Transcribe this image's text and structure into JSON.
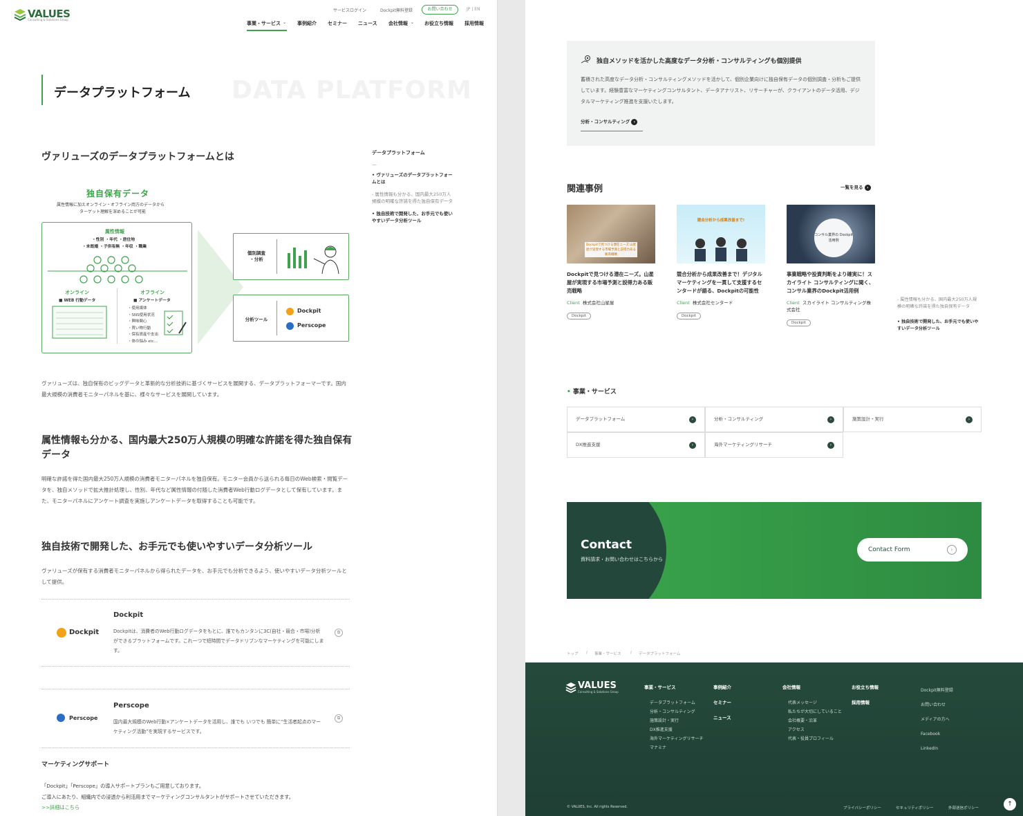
{
  "header": {
    "logo_text": "VALUES",
    "logo_sub": "Consulting & Solutions Group",
    "util": [
      "サービスログイン",
      "Dockpit無料登録"
    ],
    "contact_label": "お問い合わせ",
    "lang": "JP | EN",
    "nav": [
      "事業・サービス",
      "事例紹介",
      "セミナー",
      "ニュース",
      "会社情報",
      "お役立ち情報",
      "採用情報"
    ],
    "dropdown_marker": "⌄"
  },
  "page": {
    "title": "データプラットフォーム",
    "title_en": "DATA PLATFORM"
  },
  "toc": {
    "title": "データプラットフォーム",
    "dash": "—",
    "items": [
      "ヴァリューズのデータプラットフォームとは",
      "属性情報も分かる、国内最大250万人規模の明確な許諾を得た独自保有データ",
      "独自技術で開発した、お手元でも使いやすいデータ分析ツール"
    ]
  },
  "section1": {
    "heading": "ヴァリューズのデータプラットフォームとは",
    "body": "ヴァリューズは、独自保有のビッグデータと革新的な分析技術に基づくサービスを展開する、データプラットフォーマーです。国内最大規模の消費者モニターパネルを基に、様々なサービスを展開しています。"
  },
  "diagram": {
    "title": "独自保有データ",
    "subtitle1": "属性情報に加えオンライン・オフライン両方のデータから",
    "subtitle2": "ターゲット理解を深めることが可能",
    "attr_title": "属性情報",
    "attr_line1": "・性別 ・年代 ・居住地",
    "attr_line2": "・未既婚 ・子供有無 ・年収 ・職業",
    "online": "オンライン",
    "online_item": "■ WEB 行動データ",
    "offline": "オフライン",
    "offline_item": "■ アンケートデータ",
    "offline_list": [
      "・使用媒体",
      "・SNS使用状況",
      "・興味関心",
      "・買い物行動",
      "・保有資産や支出",
      "・体の悩み etc..."
    ],
    "box1_label": "個別調査\n・分析",
    "box2_label": "分析ツール",
    "tool1": "Dockpit",
    "tool2": "Perscope"
  },
  "section2": {
    "heading": "属性情報も分かる、国内最大250万人規模の明確な許諾を得た独自保有データ",
    "body": "明確な許諾を得た国内最大250万人規模の消費者モニターパネルを独自保有。モニター会員から送られる毎日のWeb検索・閲覧データを、独自メソッドで拡大推計処理し、性別、年代など属性情報の付随した消費者Web行動ログデータとして保有しています。また、モニターパネルにアンケート調査を実施しアンケートデータを取得することも可能です。"
  },
  "section3": {
    "heading": "独自技術で開発した、お手元でも使いやすいデータ分析ツール",
    "body": "ヴァリューズが保有する消費者モニターパネルから得られたデータを、お手元でも分析できるよう、使いやすいデータ分析ツールとして提供。",
    "tools": [
      {
        "logo": "Dockpit",
        "name": "Dockpit",
        "desc": "Dockpitは、消費者のWeb行動ログデータをもとに、誰でもカンタンに3C(自社・競合・市場)分析ができるプラットフォームです。これ一つで短時間でデータドリブンなマーケティングを可能にします。"
      },
      {
        "logo": "Perscope",
        "name": "Perscope",
        "desc": "国内最大規模のWeb行動×アンケートデータを活用し、誰でも いつでも 簡単に“生活者起点のマーケティング活動”を実現するサービスです。"
      }
    ],
    "support_heading": "マーケティングサポート",
    "support_body1": "「Dockpit」「Perscope」の導入サポートプランもご用意しております。",
    "support_body2": "ご導入にあたり、組織内での浸透から利活用までマーケティングコンサルタントがサポートさせていただきます。",
    "support_link": ">>詳細はこちら"
  },
  "consult": {
    "heading": "独自メソッドを活かした高度なデータ分析・コンサルティングも個別提供",
    "body": "蓄積された高度なデータ分析・コンサルティングメソッドを活かして、個別企業向けに独自保有データの個別調査・分析もご提供しています。経験豊富なマーケティングコンサルタント、データアナリスト、リサーチャーが、クライアントのデータ活用、デジタルマーケティング推進を支援いたします。",
    "link": "分析・コンサルティング"
  },
  "cases": {
    "heading": "関連事例",
    "more": "一覧を見る",
    "client_label": "Client",
    "items": [
      {
        "title": "Dockpitで見つける潜在ニーズ。山星屋が実現する市場予測と説得力ある販売戦略",
        "client": "株式会社山星屋",
        "tag": "Dockpit",
        "img_caption": "Dockpitで見つける潜在ニーズ 山星屋が実現する市場予測と説得力ある販売戦略"
      },
      {
        "title": "競合分析から成果改善まで！デジタルマーケティングを一貫して支援するセンタードが語る、Dockpitの可能性",
        "client": "株式会社センタード",
        "tag": "Dockpit",
        "img_caption": "競合分析から成果改善まで!"
      },
      {
        "title": "事業戦略や投資判断をより確実に！スカイライト コンサルティングに聞く、コンサル業界のDockpit活用例",
        "client": "スカイライト コンサルティング株式会社",
        "tag": "Dockpit",
        "img_caption": "コンサル業界の Dockpit活用例"
      }
    ]
  },
  "right_toc": [
    "属性情報も分かる、国内最大250万人規模の明確な許諾を得た独自保有データ",
    "独自技術で開発した、お手元でも使いやすいデータ分析ツール"
  ],
  "services": {
    "heading": "事業・サービス",
    "items": [
      "データプラットフォーム",
      "分析・コンサルティング",
      "施策設計・実行",
      "DX推進支援",
      "海外マーケティングリサーチ"
    ]
  },
  "contact": {
    "title": "Contact",
    "sub": "資料請求・お問い合わせはこちらから",
    "button": "Contact Form"
  },
  "breadcrumb": [
    "トップ",
    "/",
    "事業・サービス",
    "/",
    "データプラットフォーム"
  ],
  "footer": {
    "cols": [
      {
        "h": "事業・サービス",
        "subs": [
          "データプラットフォーム",
          "分析・コンサルティング",
          "施策設計・実行",
          "DX推進支援",
          "海外マーケティングリサーチ",
          "マナミナ"
        ]
      },
      {
        "h": "事例紹介",
        "extra": [
          "セミナー",
          "ニュース"
        ]
      },
      {
        "h": "会社情報",
        "subs": [
          "代表メッセージ",
          "私たちが大切にしていること",
          "会社概要・沿革",
          "アクセス",
          "代表・役員プロフィール"
        ]
      },
      {
        "h": "お役立ち情報",
        "extra": [
          "採用情報"
        ]
      }
    ],
    "links": [
      "Dockpit無料登録",
      "お問い合わせ",
      "メディアの方へ",
      "Facebook",
      "LinkedIn"
    ],
    "copyright": "© VALUES, Inc. All rights Reserved.",
    "policies": [
      "プライバシーポリシー",
      "セキュリティポリシー",
      "外部送信ポリシー"
    ],
    "to_top": "↑"
  }
}
